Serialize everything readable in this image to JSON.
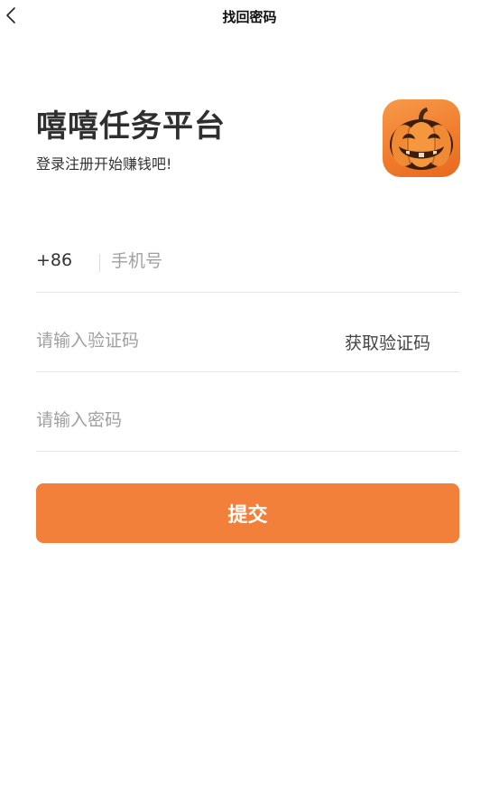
{
  "navbar": {
    "title": "找回密码",
    "back_icon": "chevron-left-icon"
  },
  "brand": {
    "title": "嘻嘻任务平台",
    "subtitle": "登录注册开始赚钱吧!",
    "logo_icon": "pumpkin-icon"
  },
  "form": {
    "country_code": "+86",
    "phone_placeholder": "手机号",
    "phone_value": "",
    "code_placeholder": "请输入验证码",
    "code_value": "",
    "get_code_label": "获取验证码",
    "password_placeholder": "请输入密码",
    "password_value": ""
  },
  "actions": {
    "submit_label": "提交"
  },
  "colors": {
    "accent": "#f3803a",
    "text_primary": "#333333",
    "placeholder": "#a0a0a0",
    "divider": "#e6e6e6"
  }
}
